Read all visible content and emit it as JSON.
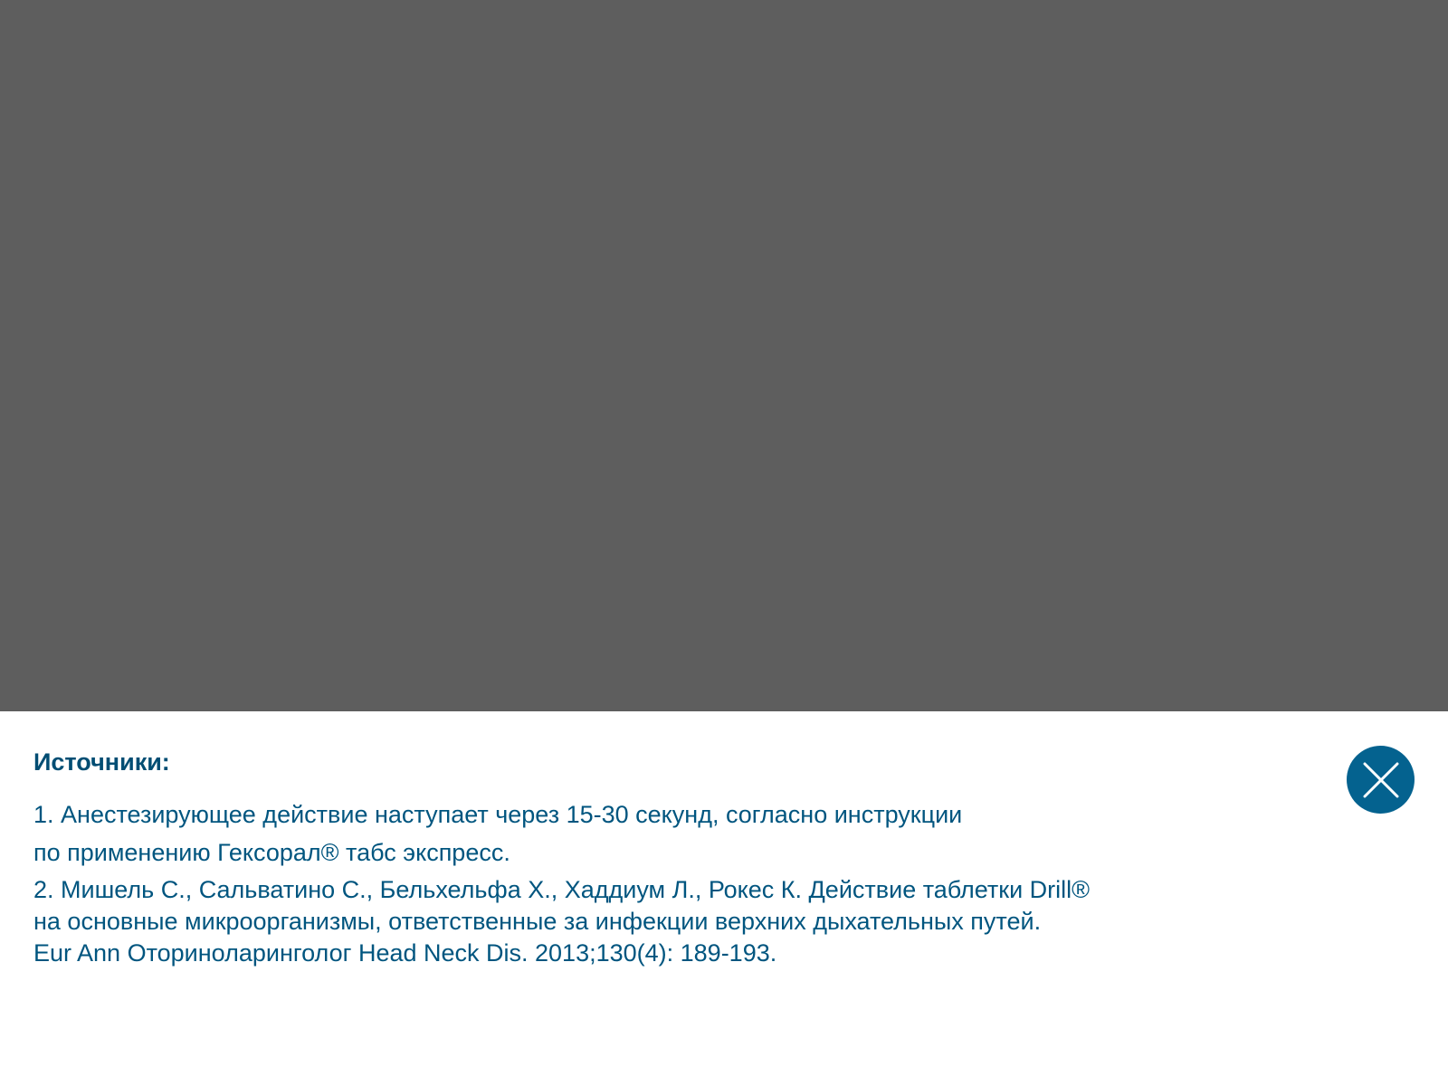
{
  "sources": {
    "title": "Источники:",
    "references": [
      {
        "lines": [
          "1. Анестезирующее действие наступает через 15-30 секунд, согласно инструкции",
          "по применению Гексорал® табс экспресс."
        ]
      },
      {
        "lines": [
          "2. Мишель С., Сальватино С., Бельхельфа Х., Хаддиум Л., Рокес К. Действие таблетки Drill®",
          "на основные микроорганизмы, ответственные за инфекции верхних дыхательных путей.",
          "Eur Ann Оториноларинголог Head Neck Dis. 2013;130(4): 189-193."
        ]
      }
    ]
  },
  "close_button": {
    "icon": "close-icon"
  },
  "colors": {
    "overlay": "#5e5e5e",
    "sheet_background": "#ffffff",
    "heading_text": "#004d73",
    "body_text": "#00557f",
    "close_button_bg": "#04628f",
    "close_icon": "#ffffff"
  }
}
